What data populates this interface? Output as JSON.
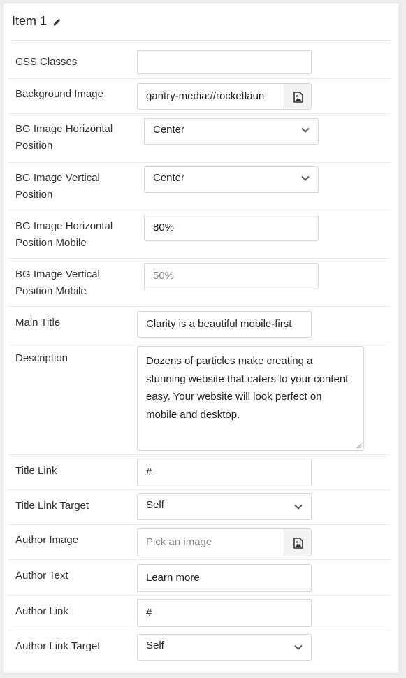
{
  "panel": {
    "title": "Item 1",
    "title_icon": "pencil-icon"
  },
  "fields": {
    "css_classes": {
      "label": "CSS Classes",
      "value": ""
    },
    "background_image": {
      "label": "Background Image",
      "value": "gantry-media://rocketlaun",
      "button_icon": "image-file-icon"
    },
    "bg_h_pos": {
      "label": "BG Image Horizontal Position",
      "value": "Center"
    },
    "bg_v_pos": {
      "label": "BG Image Vertical Position",
      "value": "Center"
    },
    "bg_h_pos_mobile": {
      "label": "BG Image Horizontal Position Mobile",
      "value": "80%"
    },
    "bg_v_pos_mobile": {
      "label": "BG Image Vertical Position Mobile",
      "placeholder": "50%"
    },
    "main_title": {
      "label": "Main Title",
      "value": "Clarity is a beautiful mobile-first"
    },
    "description": {
      "label": "Description",
      "value": "Dozens of particles make creating a stunning website that caters to your content easy. Your website will look perfect on mobile and desktop."
    },
    "title_link": {
      "label": "Title Link",
      "value": "#"
    },
    "title_link_target": {
      "label": "Title Link Target",
      "value": "Self"
    },
    "author_image": {
      "label": "Author Image",
      "placeholder": "Pick an image",
      "button_icon": "image-file-icon"
    },
    "author_text": {
      "label": "Author Text",
      "value": "Learn more"
    },
    "author_link": {
      "label": "Author Link",
      "value": "#"
    },
    "author_link_target": {
      "label": "Author Link Target",
      "value": "Self"
    }
  }
}
